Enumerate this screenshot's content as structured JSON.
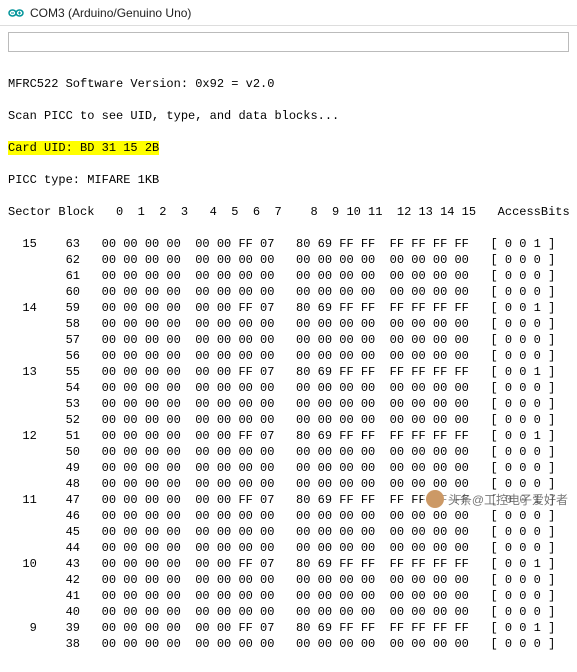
{
  "window": {
    "title": "COM3 (Arduino/Genuino Uno)"
  },
  "input": {
    "value": "",
    "placeholder": ""
  },
  "info": {
    "version_line": "MFRC522 Software Version: 0x92 = v2.0",
    "scan_line": "Scan PICC to see UID, type, and data blocks...",
    "card_uid_line": "Card UID: BD 31 15 2B",
    "picc_type_line": "PICC type: MIFARE 1KB"
  },
  "table": {
    "header": "Sector Block   0  1  2  3   4  5  6  7    8  9 10 11  12 13 14 15   AccessBits",
    "sectors": [
      {
        "sector": 15,
        "blocks": [
          {
            "blk": 63,
            "b": [
              "00",
              "00",
              "00",
              "00",
              "00",
              "00",
              "FF",
              "07",
              "80",
              "69",
              "FF",
              "FF",
              "FF",
              "FF",
              "FF",
              "FF"
            ],
            "a": "[ 0 0 1 ]"
          },
          {
            "blk": 62,
            "b": [
              "00",
              "00",
              "00",
              "00",
              "00",
              "00",
              "00",
              "00",
              "00",
              "00",
              "00",
              "00",
              "00",
              "00",
              "00",
              "00"
            ],
            "a": "[ 0 0 0 ]"
          },
          {
            "blk": 61,
            "b": [
              "00",
              "00",
              "00",
              "00",
              "00",
              "00",
              "00",
              "00",
              "00",
              "00",
              "00",
              "00",
              "00",
              "00",
              "00",
              "00"
            ],
            "a": "[ 0 0 0 ]"
          },
          {
            "blk": 60,
            "b": [
              "00",
              "00",
              "00",
              "00",
              "00",
              "00",
              "00",
              "00",
              "00",
              "00",
              "00",
              "00",
              "00",
              "00",
              "00",
              "00"
            ],
            "a": "[ 0 0 0 ]"
          }
        ]
      },
      {
        "sector": 14,
        "blocks": [
          {
            "blk": 59,
            "b": [
              "00",
              "00",
              "00",
              "00",
              "00",
              "00",
              "FF",
              "07",
              "80",
              "69",
              "FF",
              "FF",
              "FF",
              "FF",
              "FF",
              "FF"
            ],
            "a": "[ 0 0 1 ]"
          },
          {
            "blk": 58,
            "b": [
              "00",
              "00",
              "00",
              "00",
              "00",
              "00",
              "00",
              "00",
              "00",
              "00",
              "00",
              "00",
              "00",
              "00",
              "00",
              "00"
            ],
            "a": "[ 0 0 0 ]"
          },
          {
            "blk": 57,
            "b": [
              "00",
              "00",
              "00",
              "00",
              "00",
              "00",
              "00",
              "00",
              "00",
              "00",
              "00",
              "00",
              "00",
              "00",
              "00",
              "00"
            ],
            "a": "[ 0 0 0 ]"
          },
          {
            "blk": 56,
            "b": [
              "00",
              "00",
              "00",
              "00",
              "00",
              "00",
              "00",
              "00",
              "00",
              "00",
              "00",
              "00",
              "00",
              "00",
              "00",
              "00"
            ],
            "a": "[ 0 0 0 ]"
          }
        ]
      },
      {
        "sector": 13,
        "blocks": [
          {
            "blk": 55,
            "b": [
              "00",
              "00",
              "00",
              "00",
              "00",
              "00",
              "FF",
              "07",
              "80",
              "69",
              "FF",
              "FF",
              "FF",
              "FF",
              "FF",
              "FF"
            ],
            "a": "[ 0 0 1 ]"
          },
          {
            "blk": 54,
            "b": [
              "00",
              "00",
              "00",
              "00",
              "00",
              "00",
              "00",
              "00",
              "00",
              "00",
              "00",
              "00",
              "00",
              "00",
              "00",
              "00"
            ],
            "a": "[ 0 0 0 ]"
          },
          {
            "blk": 53,
            "b": [
              "00",
              "00",
              "00",
              "00",
              "00",
              "00",
              "00",
              "00",
              "00",
              "00",
              "00",
              "00",
              "00",
              "00",
              "00",
              "00"
            ],
            "a": "[ 0 0 0 ]"
          },
          {
            "blk": 52,
            "b": [
              "00",
              "00",
              "00",
              "00",
              "00",
              "00",
              "00",
              "00",
              "00",
              "00",
              "00",
              "00",
              "00",
              "00",
              "00",
              "00"
            ],
            "a": "[ 0 0 0 ]"
          }
        ]
      },
      {
        "sector": 12,
        "blocks": [
          {
            "blk": 51,
            "b": [
              "00",
              "00",
              "00",
              "00",
              "00",
              "00",
              "FF",
              "07",
              "80",
              "69",
              "FF",
              "FF",
              "FF",
              "FF",
              "FF",
              "FF"
            ],
            "a": "[ 0 0 1 ]"
          },
          {
            "blk": 50,
            "b": [
              "00",
              "00",
              "00",
              "00",
              "00",
              "00",
              "00",
              "00",
              "00",
              "00",
              "00",
              "00",
              "00",
              "00",
              "00",
              "00"
            ],
            "a": "[ 0 0 0 ]"
          },
          {
            "blk": 49,
            "b": [
              "00",
              "00",
              "00",
              "00",
              "00",
              "00",
              "00",
              "00",
              "00",
              "00",
              "00",
              "00",
              "00",
              "00",
              "00",
              "00"
            ],
            "a": "[ 0 0 0 ]"
          },
          {
            "blk": 48,
            "b": [
              "00",
              "00",
              "00",
              "00",
              "00",
              "00",
              "00",
              "00",
              "00",
              "00",
              "00",
              "00",
              "00",
              "00",
              "00",
              "00"
            ],
            "a": "[ 0 0 0 ]"
          }
        ]
      },
      {
        "sector": 11,
        "blocks": [
          {
            "blk": 47,
            "b": [
              "00",
              "00",
              "00",
              "00",
              "00",
              "00",
              "FF",
              "07",
              "80",
              "69",
              "FF",
              "FF",
              "FF",
              "FF",
              "FF",
              "FF"
            ],
            "a": "[ 0 0 1 ]"
          },
          {
            "blk": 46,
            "b": [
              "00",
              "00",
              "00",
              "00",
              "00",
              "00",
              "00",
              "00",
              "00",
              "00",
              "00",
              "00",
              "00",
              "00",
              "00",
              "00"
            ],
            "a": "[ 0 0 0 ]"
          },
          {
            "blk": 45,
            "b": [
              "00",
              "00",
              "00",
              "00",
              "00",
              "00",
              "00",
              "00",
              "00",
              "00",
              "00",
              "00",
              "00",
              "00",
              "00",
              "00"
            ],
            "a": "[ 0 0 0 ]"
          },
          {
            "blk": 44,
            "b": [
              "00",
              "00",
              "00",
              "00",
              "00",
              "00",
              "00",
              "00",
              "00",
              "00",
              "00",
              "00",
              "00",
              "00",
              "00",
              "00"
            ],
            "a": "[ 0 0 0 ]"
          }
        ]
      },
      {
        "sector": 10,
        "blocks": [
          {
            "blk": 43,
            "b": [
              "00",
              "00",
              "00",
              "00",
              "00",
              "00",
              "FF",
              "07",
              "80",
              "69",
              "FF",
              "FF",
              "FF",
              "FF",
              "FF",
              "FF"
            ],
            "a": "[ 0 0 1 ]"
          },
          {
            "blk": 42,
            "b": [
              "00",
              "00",
              "00",
              "00",
              "00",
              "00",
              "00",
              "00",
              "00",
              "00",
              "00",
              "00",
              "00",
              "00",
              "00",
              "00"
            ],
            "a": "[ 0 0 0 ]"
          },
          {
            "blk": 41,
            "b": [
              "00",
              "00",
              "00",
              "00",
              "00",
              "00",
              "00",
              "00",
              "00",
              "00",
              "00",
              "00",
              "00",
              "00",
              "00",
              "00"
            ],
            "a": "[ 0 0 0 ]"
          },
          {
            "blk": 40,
            "b": [
              "00",
              "00",
              "00",
              "00",
              "00",
              "00",
              "00",
              "00",
              "00",
              "00",
              "00",
              "00",
              "00",
              "00",
              "00",
              "00"
            ],
            "a": "[ 0 0 0 ]"
          }
        ]
      },
      {
        "sector": 9,
        "blocks": [
          {
            "blk": 39,
            "b": [
              "00",
              "00",
              "00",
              "00",
              "00",
              "00",
              "FF",
              "07",
              "80",
              "69",
              "FF",
              "FF",
              "FF",
              "FF",
              "FF",
              "FF"
            ],
            "a": "[ 0 0 1 ]"
          },
          {
            "blk": 38,
            "b": [
              "00",
              "00",
              "00",
              "00",
              "00",
              "00",
              "00",
              "00",
              "00",
              "00",
              "00",
              "00",
              "00",
              "00",
              "00",
              "00"
            ],
            "a": "[ 0 0 0 ]"
          }
        ]
      }
    ]
  },
  "watermark": {
    "text": "头条@工控电子爱好者"
  }
}
